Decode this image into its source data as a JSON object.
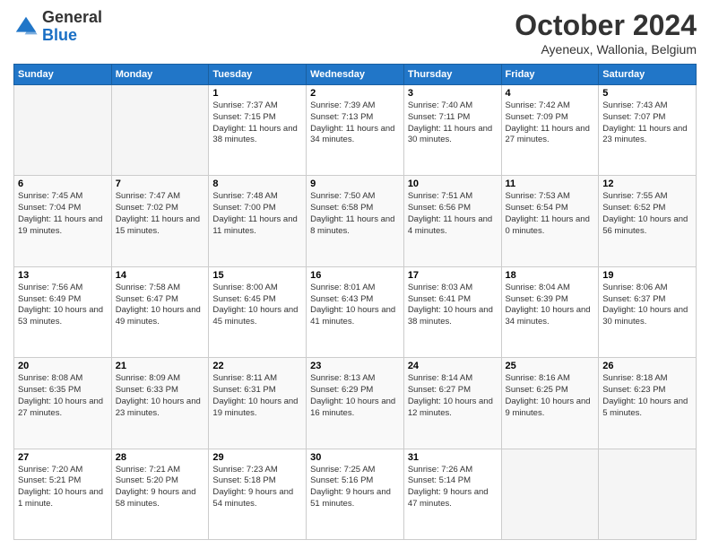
{
  "header": {
    "logo_line1": "General",
    "logo_line2": "Blue",
    "title": "October 2024",
    "subtitle": "Ayeneux, Wallonia, Belgium"
  },
  "weekdays": [
    "Sunday",
    "Monday",
    "Tuesday",
    "Wednesday",
    "Thursday",
    "Friday",
    "Saturday"
  ],
  "weeks": [
    [
      {
        "day": "",
        "info": ""
      },
      {
        "day": "",
        "info": ""
      },
      {
        "day": "1",
        "info": "Sunrise: 7:37 AM\nSunset: 7:15 PM\nDaylight: 11 hours and 38 minutes."
      },
      {
        "day": "2",
        "info": "Sunrise: 7:39 AM\nSunset: 7:13 PM\nDaylight: 11 hours and 34 minutes."
      },
      {
        "day": "3",
        "info": "Sunrise: 7:40 AM\nSunset: 7:11 PM\nDaylight: 11 hours and 30 minutes."
      },
      {
        "day": "4",
        "info": "Sunrise: 7:42 AM\nSunset: 7:09 PM\nDaylight: 11 hours and 27 minutes."
      },
      {
        "day": "5",
        "info": "Sunrise: 7:43 AM\nSunset: 7:07 PM\nDaylight: 11 hours and 23 minutes."
      }
    ],
    [
      {
        "day": "6",
        "info": "Sunrise: 7:45 AM\nSunset: 7:04 PM\nDaylight: 11 hours and 19 minutes."
      },
      {
        "day": "7",
        "info": "Sunrise: 7:47 AM\nSunset: 7:02 PM\nDaylight: 11 hours and 15 minutes."
      },
      {
        "day": "8",
        "info": "Sunrise: 7:48 AM\nSunset: 7:00 PM\nDaylight: 11 hours and 11 minutes."
      },
      {
        "day": "9",
        "info": "Sunrise: 7:50 AM\nSunset: 6:58 PM\nDaylight: 11 hours and 8 minutes."
      },
      {
        "day": "10",
        "info": "Sunrise: 7:51 AM\nSunset: 6:56 PM\nDaylight: 11 hours and 4 minutes."
      },
      {
        "day": "11",
        "info": "Sunrise: 7:53 AM\nSunset: 6:54 PM\nDaylight: 11 hours and 0 minutes."
      },
      {
        "day": "12",
        "info": "Sunrise: 7:55 AM\nSunset: 6:52 PM\nDaylight: 10 hours and 56 minutes."
      }
    ],
    [
      {
        "day": "13",
        "info": "Sunrise: 7:56 AM\nSunset: 6:49 PM\nDaylight: 10 hours and 53 minutes."
      },
      {
        "day": "14",
        "info": "Sunrise: 7:58 AM\nSunset: 6:47 PM\nDaylight: 10 hours and 49 minutes."
      },
      {
        "day": "15",
        "info": "Sunrise: 8:00 AM\nSunset: 6:45 PM\nDaylight: 10 hours and 45 minutes."
      },
      {
        "day": "16",
        "info": "Sunrise: 8:01 AM\nSunset: 6:43 PM\nDaylight: 10 hours and 41 minutes."
      },
      {
        "day": "17",
        "info": "Sunrise: 8:03 AM\nSunset: 6:41 PM\nDaylight: 10 hours and 38 minutes."
      },
      {
        "day": "18",
        "info": "Sunrise: 8:04 AM\nSunset: 6:39 PM\nDaylight: 10 hours and 34 minutes."
      },
      {
        "day": "19",
        "info": "Sunrise: 8:06 AM\nSunset: 6:37 PM\nDaylight: 10 hours and 30 minutes."
      }
    ],
    [
      {
        "day": "20",
        "info": "Sunrise: 8:08 AM\nSunset: 6:35 PM\nDaylight: 10 hours and 27 minutes."
      },
      {
        "day": "21",
        "info": "Sunrise: 8:09 AM\nSunset: 6:33 PM\nDaylight: 10 hours and 23 minutes."
      },
      {
        "day": "22",
        "info": "Sunrise: 8:11 AM\nSunset: 6:31 PM\nDaylight: 10 hours and 19 minutes."
      },
      {
        "day": "23",
        "info": "Sunrise: 8:13 AM\nSunset: 6:29 PM\nDaylight: 10 hours and 16 minutes."
      },
      {
        "day": "24",
        "info": "Sunrise: 8:14 AM\nSunset: 6:27 PM\nDaylight: 10 hours and 12 minutes."
      },
      {
        "day": "25",
        "info": "Sunrise: 8:16 AM\nSunset: 6:25 PM\nDaylight: 10 hours and 9 minutes."
      },
      {
        "day": "26",
        "info": "Sunrise: 8:18 AM\nSunset: 6:23 PM\nDaylight: 10 hours and 5 minutes."
      }
    ],
    [
      {
        "day": "27",
        "info": "Sunrise: 7:20 AM\nSunset: 5:21 PM\nDaylight: 10 hours and 1 minute."
      },
      {
        "day": "28",
        "info": "Sunrise: 7:21 AM\nSunset: 5:20 PM\nDaylight: 9 hours and 58 minutes."
      },
      {
        "day": "29",
        "info": "Sunrise: 7:23 AM\nSunset: 5:18 PM\nDaylight: 9 hours and 54 minutes."
      },
      {
        "day": "30",
        "info": "Sunrise: 7:25 AM\nSunset: 5:16 PM\nDaylight: 9 hours and 51 minutes."
      },
      {
        "day": "31",
        "info": "Sunrise: 7:26 AM\nSunset: 5:14 PM\nDaylight: 9 hours and 47 minutes."
      },
      {
        "day": "",
        "info": ""
      },
      {
        "day": "",
        "info": ""
      }
    ]
  ]
}
